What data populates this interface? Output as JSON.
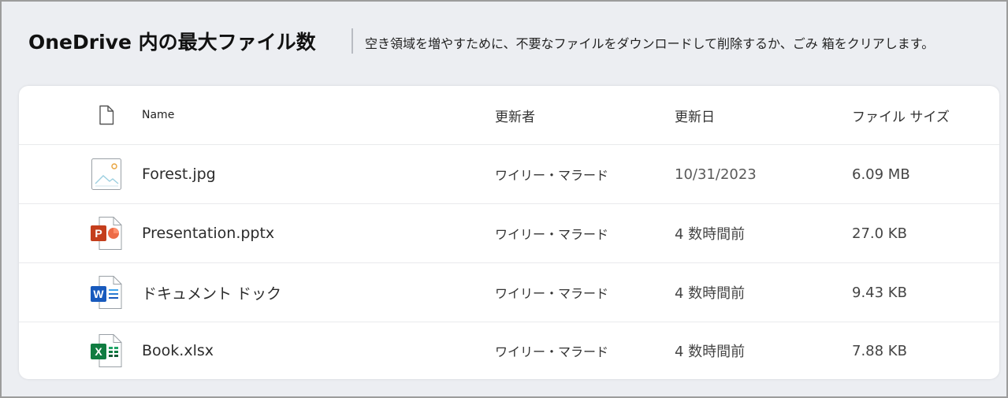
{
  "header": {
    "title": "OneDrive 内の最大ファイル数",
    "subtitle": "空き領域を増やすために、不要なファイルをダウンロードして削除するか、ごみ 箱をクリアします。"
  },
  "table": {
    "columns": {
      "icon": "file-icon",
      "name": "Name",
      "modified_by": "更新者",
      "modified_date": "更新日",
      "file_size": "ファイル サイズ"
    },
    "rows": [
      {
        "icon": "image-file-icon",
        "name": "Forest.jpg",
        "modified_by": "ワイリー・マラード",
        "modified_date": "10/31/2023",
        "file_size": "6.09 MB"
      },
      {
        "icon": "powerpoint-file-icon",
        "name": "Presentation.pptx",
        "modified_by": "ワイリー・マラード",
        "modified_date": "4 数時間前",
        "file_size": "27.0 KB"
      },
      {
        "icon": "word-file-icon",
        "name": "ドキュメント ドック",
        "modified_by": "ワイリー・マラード",
        "modified_date": "4 数時間前",
        "file_size": "9.43 KB"
      },
      {
        "icon": "excel-file-icon",
        "name": "Book.xlsx",
        "modified_by": "ワイリー・マラード",
        "modified_date": "4 数時間前",
        "file_size": "7.88 KB"
      }
    ]
  },
  "colors": {
    "page_bg": "#eceef2",
    "card_bg": "#ffffff",
    "powerpoint": "#c43e1c",
    "word": "#185abd",
    "excel": "#107c41"
  }
}
